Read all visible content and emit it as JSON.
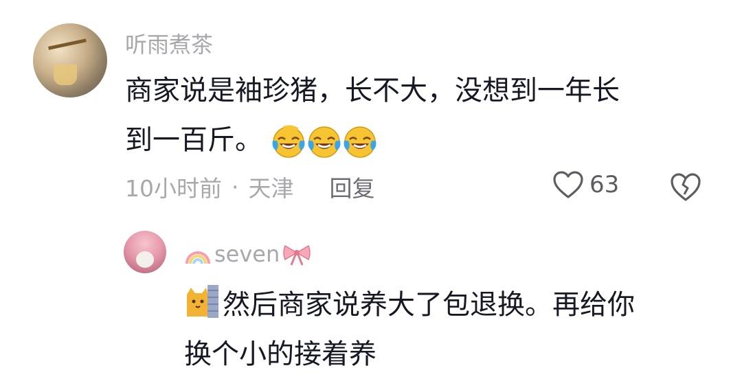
{
  "comment": {
    "username": "听雨煮茶",
    "text_line1": "商家说是袖珍猪，长不大，没想到一年长",
    "text_line2": "到一百斤。",
    "emoji_names": [
      "laughing-crying-emoji",
      "laughing-crying-emoji",
      "laughing-crying-emoji"
    ],
    "time": "10小时前",
    "separator": "·",
    "location": "天津",
    "reply_label": "回复",
    "like_count": "63"
  },
  "reply": {
    "username": "seven",
    "username_prefix_icon": "rainbow-icon",
    "username_suffix_icon": "ribbon-bow-icon",
    "lead_icon": "cat-peeking-emoji",
    "text_line1": "然后商家说养大了包退换。再给你",
    "text_line2": "换个小的接着养"
  },
  "colors": {
    "text_primary": "#161823",
    "text_secondary": "#a7a7ae",
    "icon": "#5c5c63",
    "emoji_yellow": "#f7c531",
    "tears": "#3aa6e8"
  }
}
